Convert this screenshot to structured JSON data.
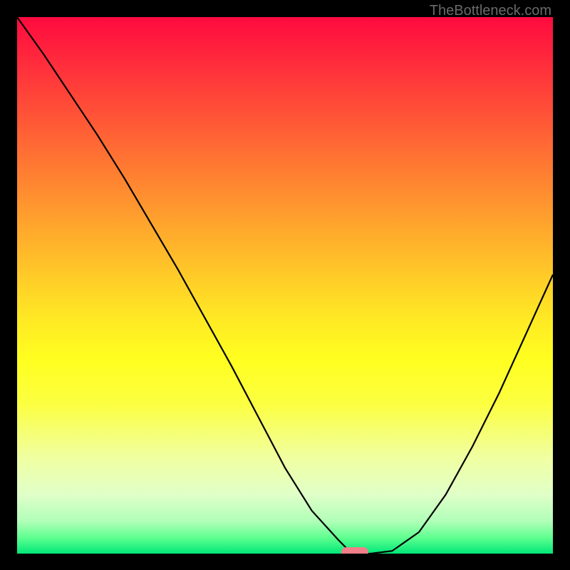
{
  "watermark": "TheBottleneck.com",
  "chart_data": {
    "type": "line",
    "title": "",
    "xlabel": "",
    "ylabel": "",
    "x_range": [
      0,
      100
    ],
    "y_range": [
      0,
      100
    ],
    "series": [
      {
        "name": "curve",
        "x": [
          0,
          5,
          10,
          15,
          20,
          25,
          30,
          35,
          40,
          45,
          50,
          55,
          60,
          62,
          64,
          66,
          70,
          75,
          80,
          85,
          90,
          95,
          100
        ],
        "y": [
          100,
          93,
          85.5,
          78,
          70,
          61.5,
          53,
          44,
          35,
          25.5,
          16,
          8,
          2.5,
          0.5,
          0,
          0,
          0.5,
          4,
          11,
          20,
          30,
          41,
          52
        ]
      }
    ],
    "marker": {
      "x": 63,
      "y": 0,
      "color": "#f27f8a"
    },
    "gradient_colors": {
      "top": "#ff0a3f",
      "middle": "#ffff20",
      "bottom": "#00e878"
    }
  }
}
